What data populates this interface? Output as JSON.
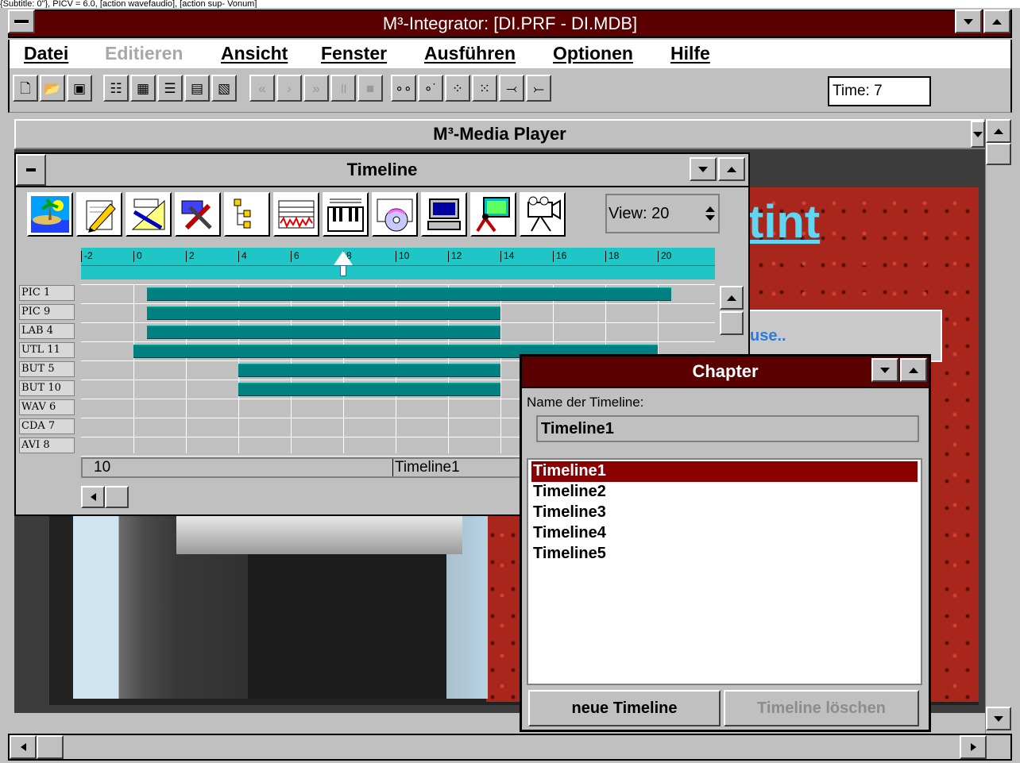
{
  "top_strip": "{Subtitle: 0\"}, PICV = 6.0, [action wavefaudio], [action sup- Vonum]",
  "window": {
    "title": "M³-Integrator: [DI.PRF - DI.MDB]"
  },
  "menu": [
    {
      "label": "Datei",
      "disabled": false
    },
    {
      "label": "Editieren",
      "disabled": true
    },
    {
      "label": "Ansicht",
      "disabled": false
    },
    {
      "label": "Fenster",
      "disabled": false
    },
    {
      "label": "Ausführen",
      "disabled": false
    },
    {
      "label": "Optionen",
      "disabled": false
    },
    {
      "label": "Hilfe",
      "disabled": false
    }
  ],
  "toolbar": {
    "buttons": [
      "new-file-icon",
      "open-folder-icon",
      "save-disk-icon",
      "properties-icon",
      "table-icon",
      "form-icon",
      "report-icon",
      "query-icon",
      "rewind-icon",
      "play-icon",
      "fast-forward-icon",
      "pause-icon",
      "stop-icon",
      "link-icon",
      "unlink-icon",
      "group-icon",
      "ungroup-icon",
      "step-back-icon",
      "step-forward-icon"
    ],
    "time": "Time: 7"
  },
  "media_player": {
    "title": "M³-Media Player",
    "tint_text": "tint",
    "ghost_link": "use.."
  },
  "timeline": {
    "title": "Timeline",
    "view": "View: 20",
    "tools": [
      "picture-icon",
      "pencil-icon",
      "drawing-tools-icon",
      "utilities-icon",
      "tree-icon",
      "wave-audio-icon",
      "midi-keyboard-icon",
      "cd-audio-icon",
      "computer-icon",
      "picture-frame-icon",
      "video-camera-icon"
    ],
    "ruler_labels": [
      "-2",
      "0",
      "2",
      "4",
      "6",
      "8",
      "10",
      "12",
      "14",
      "16",
      "18",
      "20"
    ],
    "playhead_time": 8,
    "rows": [
      {
        "label": "PIC 1",
        "start": 0.5,
        "end": 20.5
      },
      {
        "label": "PIC 9",
        "start": 0.5,
        "end": 14
      },
      {
        "label": "LAB 4",
        "start": 0.5,
        "end": 14
      },
      {
        "label": "UTL 11",
        "start": 0,
        "end": 20
      },
      {
        "label": "BUT 5",
        "start": 4,
        "end": 14
      },
      {
        "label": "BUT 10",
        "start": 4,
        "end": 14
      },
      {
        "label": "WAV 6",
        "start": null,
        "end": null
      },
      {
        "label": "CDA 7",
        "start": null,
        "end": null
      },
      {
        "label": "AVI 8",
        "start": null,
        "end": null
      }
    ],
    "bottom_value": "10",
    "bottom_name": "Timeline1"
  },
  "chapter": {
    "title": "Chapter",
    "name_label": "Name der Timeline:",
    "name_value": "Timeline1",
    "list": [
      "Timeline1",
      "Timeline2",
      "Timeline3",
      "Timeline4",
      "Timeline5"
    ],
    "selected": 0,
    "new_button": "neue Timeline",
    "delete_button": "Timeline löschen"
  },
  "colors": {
    "title_active": "#5a0000",
    "bar": "#008080",
    "ruler": "#20c6c6",
    "selection": "#8b0000"
  }
}
